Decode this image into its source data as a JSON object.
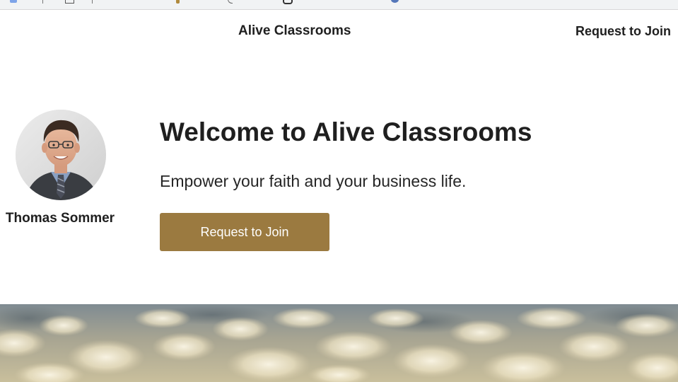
{
  "header": {
    "brand": "Alive Classrooms",
    "nav_join_label": "Request to Join"
  },
  "hero": {
    "title": "Welcome to Alive Classrooms",
    "subtitle": "Empower your faith and your business life.",
    "cta_label": "Request to Join",
    "presenter": {
      "name": "Thomas Sommer"
    }
  },
  "colors": {
    "cta_background": "#9b7a40",
    "text": "#1f1f1f",
    "page_background": "#ffffff"
  }
}
